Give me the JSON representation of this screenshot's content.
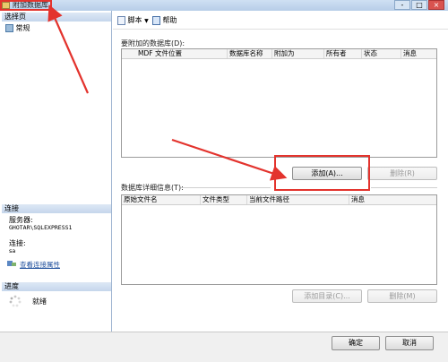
{
  "window": {
    "title": "附加数据库",
    "controls": [
      "-",
      "□",
      "×"
    ]
  },
  "left": {
    "select_page_header": "选择页",
    "pages": [
      {
        "label": "常规",
        "icon": "page-icon"
      }
    ],
    "connection_header": "连接",
    "server_label": "服务器:",
    "server_value": "GHOTAR\\SQLEXPRESS1",
    "connection_label": "连接:",
    "connection_value": "sa",
    "view_connection_link": "查看连接属性",
    "progress_header": "进度",
    "progress_status": "就绪"
  },
  "toolbar": {
    "script_label": "脚本",
    "help_label": "帮助"
  },
  "attach": {
    "group_label": "要附加的数据库(D):",
    "columns": [
      "MDF 文件位置",
      "数据库名称",
      "附加为",
      "所有者",
      "状态",
      "消息"
    ],
    "add_button": "添加(A)...",
    "remove_button": "删除(R)"
  },
  "details": {
    "group_label": "数据库详细信息(T):",
    "columns": [
      "原始文件名",
      "文件类型",
      "当前文件路径",
      "消息"
    ],
    "add_catalog_button": "添加目录(C)...",
    "remove_button": "删除(M)"
  },
  "footer": {
    "ok_button": "确定",
    "cancel_button": "取消"
  },
  "annotations": {
    "color": "#e3332d"
  }
}
